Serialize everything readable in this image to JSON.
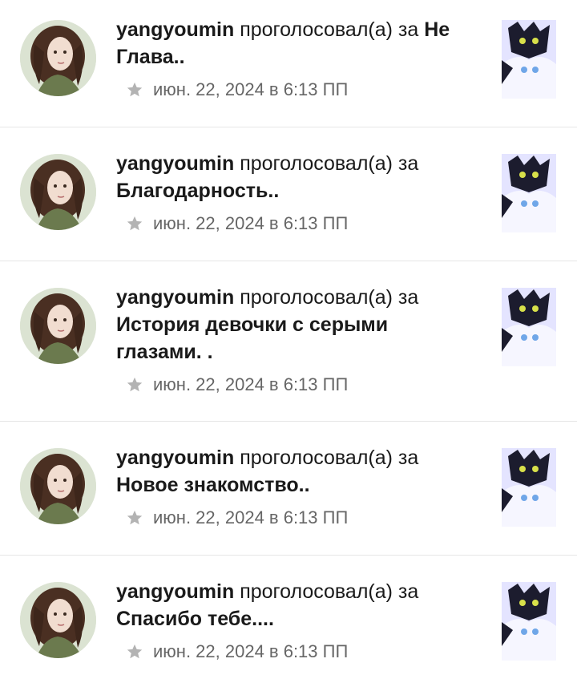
{
  "notifications": [
    {
      "username": "yangyoumin",
      "action": "проголосовал(а) за",
      "story_title": "Не Глава..",
      "timestamp": "июн. 22, 2024 в 6:13 ПП"
    },
    {
      "username": "yangyoumin",
      "action": "проголосовал(а) за",
      "story_title": "Благодарность..",
      "timestamp": "июн. 22, 2024 в 6:13 ПП"
    },
    {
      "username": "yangyoumin",
      "action": "проголосовал(а) за",
      "story_title": "История девочки с серыми глазами. .",
      "timestamp": "июн. 22, 2024 в 6:13 ПП"
    },
    {
      "username": "yangyoumin",
      "action": "проголосовал(а) за",
      "story_title": "Новое знакомство..",
      "timestamp": "июн. 22, 2024 в 6:13 ПП"
    },
    {
      "username": "yangyoumin",
      "action": "проголосовал(а) за",
      "story_title": "Спасибо тебе....",
      "timestamp": "июн. 22, 2024 в 6:13 ПП"
    }
  ],
  "icons": {
    "vote": "star-icon",
    "avatar": "user-avatar",
    "cover": "story-cover"
  },
  "colors": {
    "text": "#1a1a1a",
    "meta": "#666666",
    "star": "#b3b3b3",
    "divider": "#e6e6e6"
  }
}
